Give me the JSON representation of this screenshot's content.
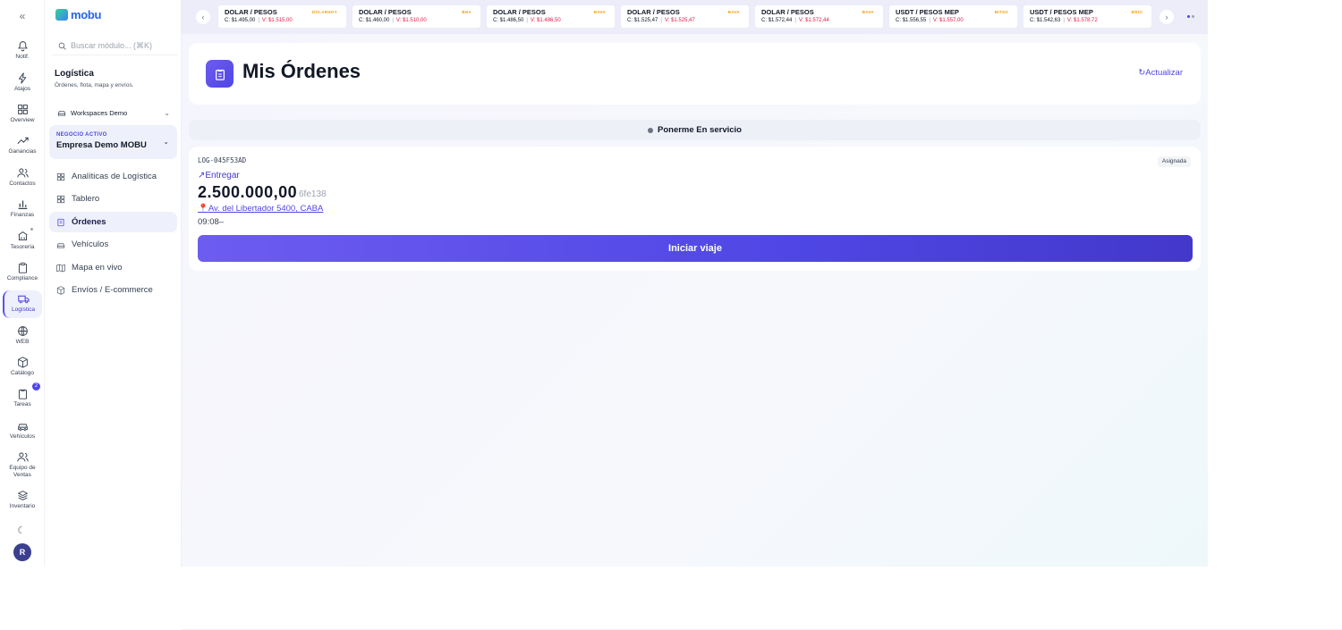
{
  "rail": {
    "items": [
      {
        "label": "Notif.",
        "icon": "bell-icon"
      },
      {
        "label": "Atajos",
        "icon": "bolt-icon"
      },
      {
        "label": "Overview",
        "icon": "grid-icon"
      },
      {
        "label": "Ganancias",
        "icon": "trend-icon"
      },
      {
        "label": "Contactos",
        "icon": "users-icon"
      },
      {
        "label": "Finanzas",
        "icon": "bar-chart-icon"
      },
      {
        "label": "Tesorería",
        "icon": "bank-icon"
      },
      {
        "label": "Compliance",
        "icon": "clipboard-icon"
      },
      {
        "label": "Logística",
        "icon": "truck-icon"
      },
      {
        "label": "WEB",
        "icon": "globe-icon"
      },
      {
        "label": "Catálogo",
        "icon": "box-icon"
      },
      {
        "label": "Tareas",
        "icon": "tasks-icon"
      },
      {
        "label": "Vehículos",
        "icon": "car-icon"
      },
      {
        "label": "Equipo de Ventas",
        "icon": "team-icon"
      },
      {
        "label": "Inventario",
        "icon": "layers-icon"
      }
    ],
    "tasks_badge": "2",
    "avatar_initial": "R"
  },
  "sidebar": {
    "brand": "mobu",
    "search_placeholder": "Buscar módulo... (⌘K)",
    "module_title": "Logística",
    "module_subtitle": "Órdenes, flota, mapa y envíos.",
    "workspace": "Workspaces Demo",
    "business_label": "NEGOCIO ACTIVO",
    "business_name": "Empresa Demo MOBU",
    "nav": [
      {
        "label": "Analíticas de Logística",
        "icon": "analytics-icon"
      },
      {
        "label": "Tablero",
        "icon": "board-icon"
      },
      {
        "label": "Órdenes",
        "icon": "orders-icon"
      },
      {
        "label": "Vehículos",
        "icon": "car-icon"
      },
      {
        "label": "Mapa en vivo",
        "icon": "map-icon"
      },
      {
        "label": "Envíos / E-commerce",
        "icon": "package-icon"
      }
    ]
  },
  "ticker": [
    {
      "pair": "DOLAR / PESOS",
      "source": "DOLARHOY",
      "buy": "C: $1.495,00",
      "sell": "V: $1.515,00"
    },
    {
      "pair": "DOLAR / PESOS",
      "source": "BNA",
      "buy": "C: $1.460,00",
      "sell": "V: $1.510,00"
    },
    {
      "pair": "DOLAR / PESOS",
      "source": "BAVA",
      "buy": "C: $1.486,50",
      "sell": "V: $1.486,50"
    },
    {
      "pair": "DOLAR / PESOS",
      "source": "BAVA",
      "buy": "C: $1.525,47",
      "sell": "V: $1.525,47"
    },
    {
      "pair": "DOLAR / PESOS",
      "source": "BAVA",
      "buy": "C: $1.572,44",
      "sell": "V: $1.572,44"
    },
    {
      "pair": "USDT / PESOS MEP",
      "source": "BITSO",
      "buy": "C: $1.556,55",
      "sell": "V: $1.557,00"
    },
    {
      "pair": "USDT / PESOS MEP",
      "source": "BRIO",
      "buy": "C: $1.542,63",
      "sell": "V: $1.578,72"
    }
  ],
  "header": {
    "title": "Mis Órdenes",
    "refresh_label": "Actualizar"
  },
  "status": {
    "label": "Ponerme En servicio"
  },
  "order": {
    "id": "LOG-045F53AD",
    "badge": "Asignada",
    "action": "Entregar",
    "amount": "2.500.000,00",
    "reference": "6fe138",
    "address": "Av. del Libertador 5400, CABA",
    "time": "09:08–",
    "cta": "Iniciar viaje"
  },
  "colors": {
    "accent": "#4f46e5",
    "sell": "#e11d48",
    "source_tag": "#f59e0b"
  }
}
